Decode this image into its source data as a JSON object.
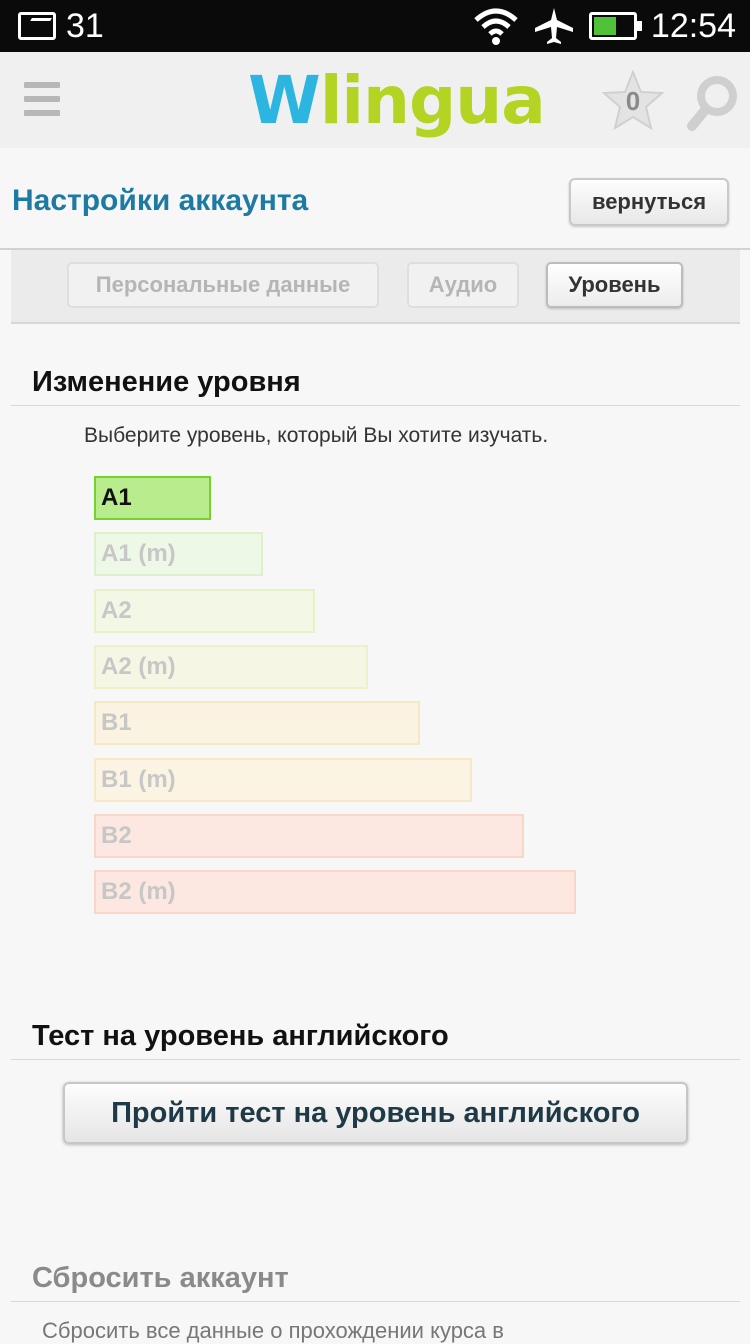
{
  "status_bar": {
    "notification_count": "31",
    "time": "12:54",
    "battery_level": 0.55,
    "icons": [
      "message-icon",
      "wifi-icon",
      "airplane-icon",
      "battery-icon"
    ]
  },
  "header": {
    "logo_w": "W",
    "logo_rest": "lingua",
    "favorites_count": "0",
    "icons": [
      "menu-icon",
      "star-icon",
      "search-icon"
    ]
  },
  "page": {
    "title": "Настройки аккаунта",
    "back_label": "вернуться"
  },
  "tabs": [
    {
      "label": "Персональные данные",
      "active": false
    },
    {
      "label": "Аудио",
      "active": false
    },
    {
      "label": "Уровень",
      "active": true
    }
  ],
  "level_section": {
    "title": "Изменение уровня",
    "hint": "Выберите уровень, который Вы хотите изучать.",
    "levels": [
      {
        "label": "A1",
        "selected": true,
        "color": "#b9ec8c",
        "border": "#74d12e"
      },
      {
        "label": "A1 (m)",
        "selected": false,
        "color": "#eef8e6",
        "border": "#dcf1c9"
      },
      {
        "label": "A2",
        "selected": false,
        "color": "#f3f8e6",
        "border": "#e8f2c9"
      },
      {
        "label": "A2 (m)",
        "selected": false,
        "color": "#f5f7e4",
        "border": "#edf0c8"
      },
      {
        "label": "B1",
        "selected": false,
        "color": "#fbf3e1",
        "border": "#f7e7c6"
      },
      {
        "label": "B1 (m)",
        "selected": false,
        "color": "#fcf4e2",
        "border": "#f8e8c6"
      },
      {
        "label": "B2",
        "selected": false,
        "color": "#fde8e1",
        "border": "#f9d6c8"
      },
      {
        "label": "B2 (m)",
        "selected": false,
        "color": "#fde8e1",
        "border": "#f9d6c8"
      }
    ]
  },
  "test_section": {
    "title": "Тест на уровень английского",
    "button_label": "Пройти тест на уровень английского"
  },
  "reset_section": {
    "title": "Сбросить аккаунт",
    "description": "Сбросить все данные о прохождении курса в"
  }
}
